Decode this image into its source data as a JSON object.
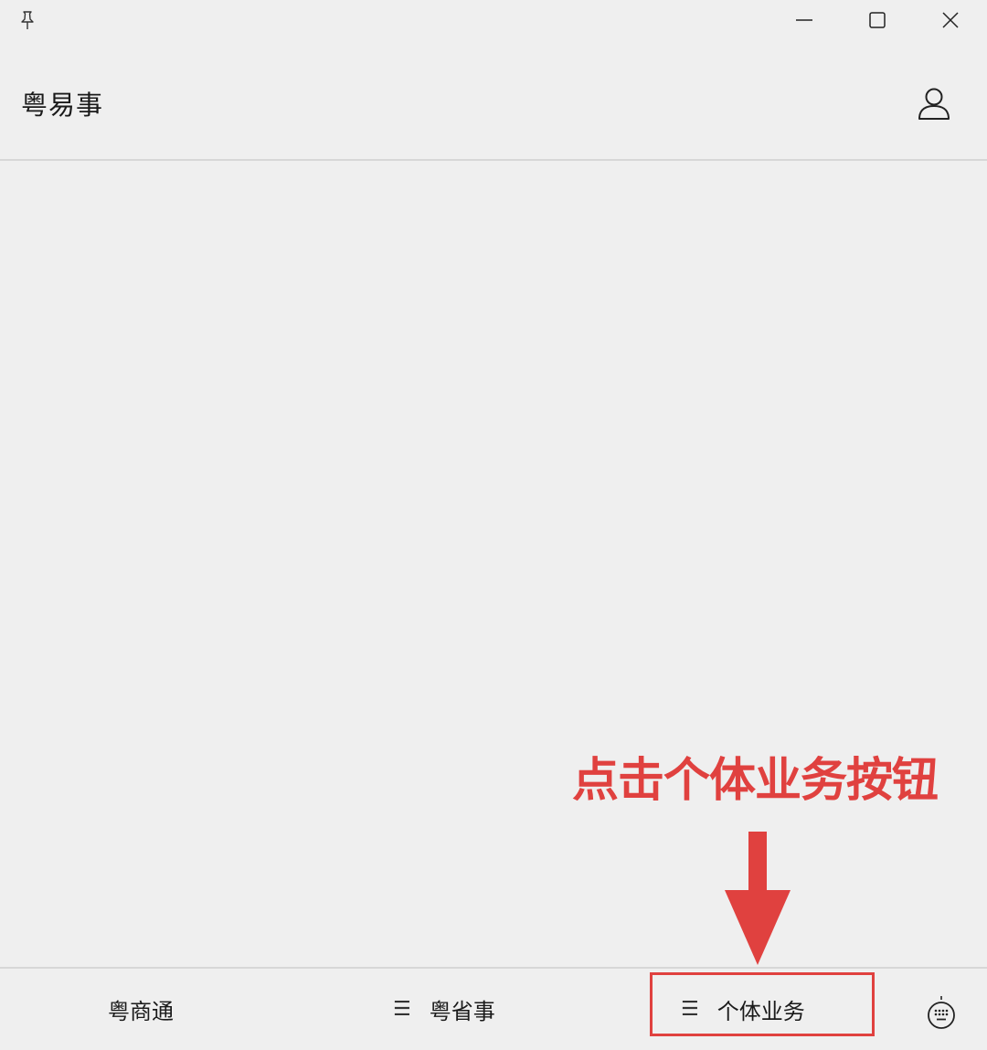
{
  "window": {
    "pin_icon": "pin-icon",
    "minimize_icon": "minimize-icon",
    "maximize_icon": "maximize-icon",
    "close_icon": "close-icon"
  },
  "header": {
    "title": "粤易事",
    "user_icon": "user-icon"
  },
  "annotation": {
    "text": "点击个体业务按钮",
    "color": "#e0413f",
    "arrow_icon": "arrow-down-icon"
  },
  "bottom_menu": {
    "items": [
      {
        "label": "粤商通",
        "has_menu_icon": false
      },
      {
        "label": "粤省事",
        "has_menu_icon": true,
        "icon_glyph": "☰"
      },
      {
        "label": "个体业务",
        "has_menu_icon": true,
        "icon_glyph": "☰"
      }
    ],
    "highlighted_item": "个体业务",
    "keyboard_icon": "keyboard-icon"
  },
  "colors": {
    "background": "#efefef",
    "divider": "#d7d7d7",
    "accent_red": "#e0413f",
    "text": "#1a1a1a"
  }
}
